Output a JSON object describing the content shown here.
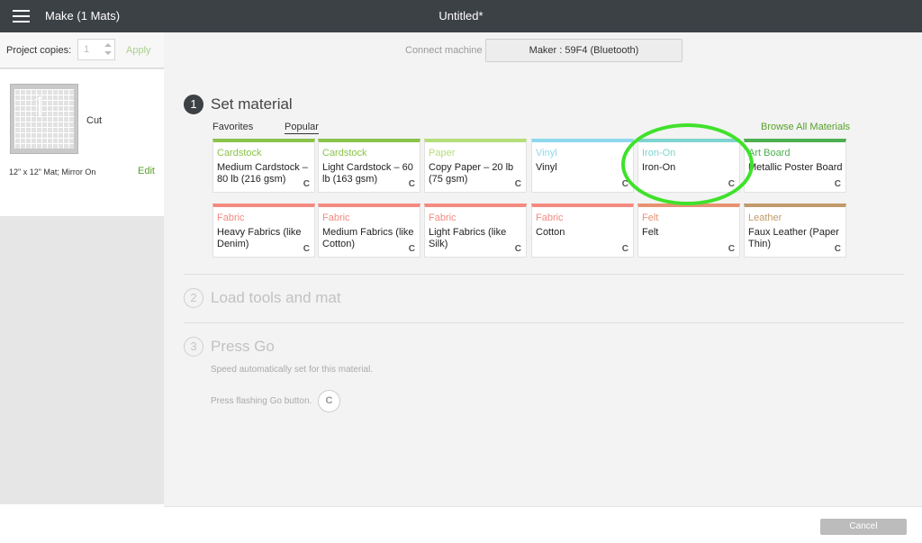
{
  "topbar": {
    "app_title": "Make (1 Mats)",
    "doc_title": "Untitled*"
  },
  "sidebar": {
    "copies_label": "Project copies:",
    "copies_value": "1",
    "apply_label": "Apply",
    "mat": {
      "glyph": "1",
      "cut_label": "Cut",
      "description": "12\" x 12\" Mat; Mirror On",
      "edit_label": "Edit"
    }
  },
  "machine": {
    "connect_label": "Connect machine",
    "device": "Maker : 59F4 (Bluetooth)"
  },
  "steps": [
    {
      "number": "1",
      "title": "Set material"
    },
    {
      "number": "2",
      "title": "Load tools and mat"
    },
    {
      "number": "3",
      "title": "Press Go"
    }
  ],
  "material": {
    "tabs": [
      {
        "label": "Favorites"
      },
      {
        "label": "Popular"
      }
    ],
    "selected_tab": "Popular",
    "browse_label": "Browse All Materials",
    "tiles": [
      {
        "category": "Cardstock",
        "name": "Medium Cardstock – 80 lb (216 gsm)",
        "color": "#8bc34a"
      },
      {
        "category": "Cardstock",
        "name": "Light Cardstock – 60 lb (163 gsm)",
        "color": "#8bc34a"
      },
      {
        "category": "Paper",
        "name": "Copy Paper – 20 lb (75 gsm)",
        "color": "#b5dd7a"
      },
      {
        "category": "Vinyl",
        "name": "Vinyl",
        "color": "#8fd8ee"
      },
      {
        "category": "Iron-On",
        "name": "Iron-On",
        "color": "#7fd4cf"
      },
      {
        "category": "Art Board",
        "name": "Metallic Poster Board",
        "color": "#4caf50"
      },
      {
        "category": "Fabric",
        "name": "Heavy Fabrics (like Denim)",
        "color": "#f48a80"
      },
      {
        "category": "Fabric",
        "name": "Medium Fabrics (like Cotton)",
        "color": "#f48a80"
      },
      {
        "category": "Fabric",
        "name": "Light Fabrics (like Silk)",
        "color": "#f48a80"
      },
      {
        "category": "Fabric",
        "name": "Cotton",
        "color": "#f48a80"
      },
      {
        "category": "Felt",
        "name": "Felt",
        "color": "#e89273"
      },
      {
        "category": "Leather",
        "name": "Faux Leather (Paper Thin)",
        "color": "#c29a6c"
      }
    ],
    "cricut_icon_glyph": "C"
  },
  "press_go": {
    "speed_hint": "Speed automatically set for this material.",
    "go_hint": "Press flashing Go button.",
    "go_glyph": "C"
  },
  "footer": {
    "cancel_label": "Cancel"
  },
  "colors": {
    "topbar": "#3c4146",
    "accent_green": "#5aa02c",
    "highlight_ring": "#3fe12b"
  }
}
